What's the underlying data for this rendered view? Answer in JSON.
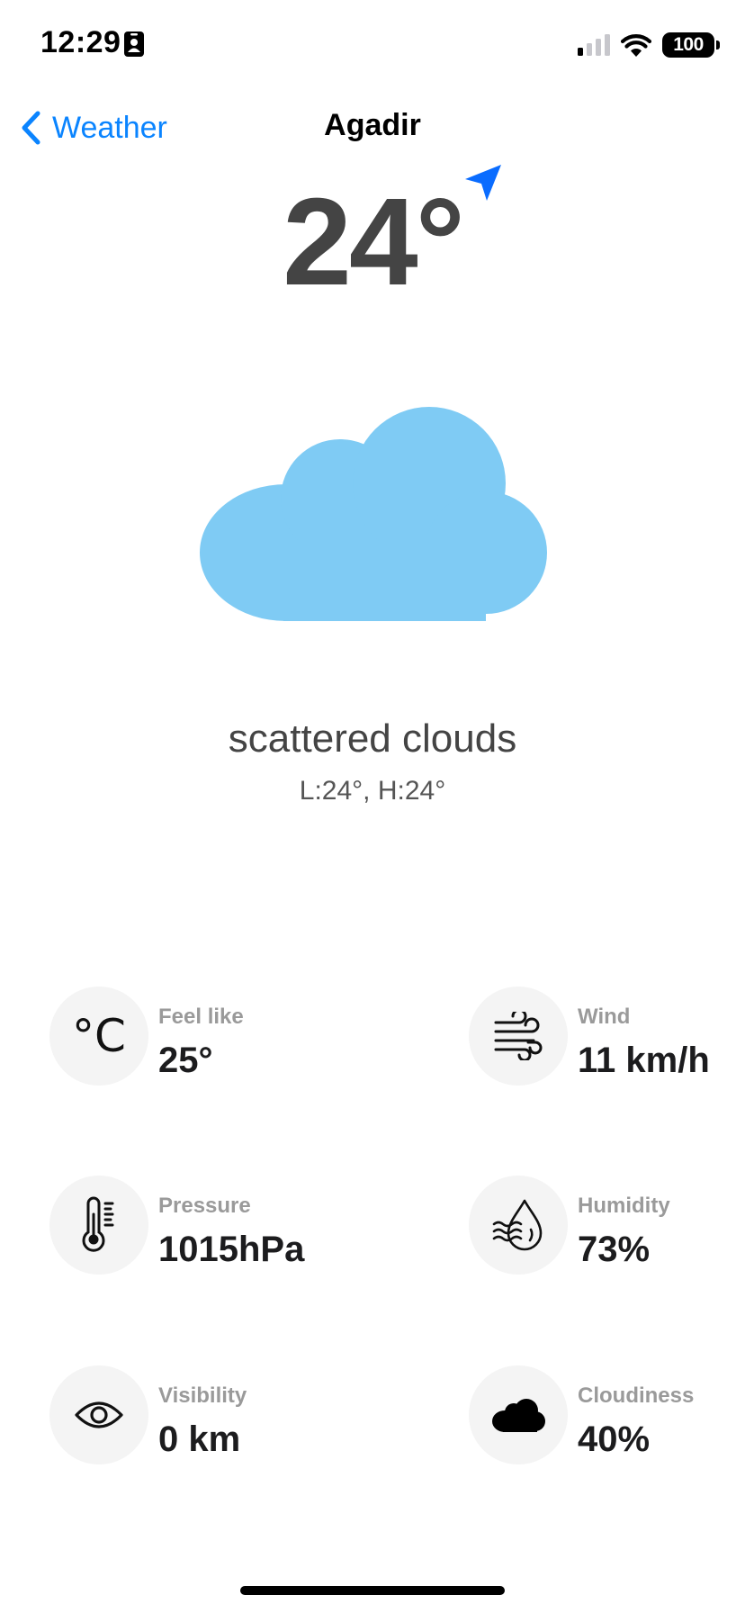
{
  "status_bar": {
    "time": "12:29",
    "battery": "100",
    "icons": [
      "contact-card-icon",
      "cellular-signal-icon",
      "wifi-icon",
      "battery-icon"
    ]
  },
  "nav": {
    "back_label": "Weather",
    "title": "Agadir"
  },
  "current": {
    "temperature": "24°",
    "description": "scattered clouds",
    "low_high": "L:24°, H:24°",
    "weather_icon": "cloud-icon",
    "location_icon": "location-arrow-icon"
  },
  "colors": {
    "accent": "#0a84ff",
    "cloud": "#7fcbf4",
    "metric_circle": "#f4f4f4",
    "primary_text": "#444444",
    "label_text": "#9a9a9a"
  },
  "metrics": [
    {
      "label": "Feel like",
      "value": "25°",
      "icon": "celsius-icon",
      "icon_glyph": "°C"
    },
    {
      "label": "Wind",
      "value": "11 km/h",
      "icon": "wind-icon"
    },
    {
      "label": "Pressure",
      "value": "1015hPa",
      "icon": "thermometer-icon"
    },
    {
      "label": "Humidity",
      "value": "73%",
      "icon": "humidity-icon"
    },
    {
      "label": "Visibility",
      "value": "0 km",
      "icon": "eye-icon"
    },
    {
      "label": "Cloudiness",
      "value": "40%",
      "icon": "cloud-filled-icon"
    }
  ]
}
